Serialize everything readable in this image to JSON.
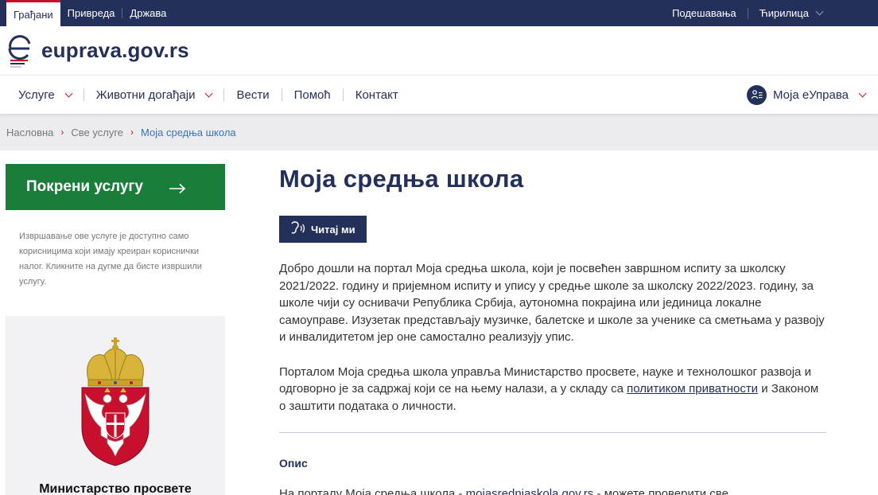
{
  "topbar": {
    "audiences": [
      "Грађани",
      "Привреда",
      "Држава"
    ],
    "settings": "Подешавања",
    "language": "Ћирилица"
  },
  "logo": {
    "text": "euprava.gov.rs"
  },
  "nav": {
    "services": "Услуге",
    "life_events": "Животни догађаји",
    "news": "Вести",
    "help": "Помоћ",
    "contact": "Контакт",
    "account": "Моја еУправа"
  },
  "breadcrumb": {
    "home": "Насловна",
    "all_services": "Све услуге",
    "current": "Моја средња школа"
  },
  "sidebar": {
    "start_button": "Покрени услугу",
    "note": "Извршавање ове услуге је доступно само корисницима који имају креиран кориснички налог. Кликните на дугме да бисте извршили услугу.",
    "ministry_name": "Министарство просвете"
  },
  "main": {
    "title": "Моја средња школа",
    "read_button": "Читај ми",
    "paragraph1": "Добро дошли на портал Моја средња школа, који је посвећен завршном испиту за школску 2021/2022. годину и пријемном испиту и упису у средње школе за школску 2022/2023. годину, за школе чији су оснивачи Република Србија, аутономна покрајина или јединица локалне самоуправе. Изузетак представљају музичке, балетске и школе за ученике са сметњама у развоју и инвалидитетом јер оне самостално реализују упис.",
    "paragraph2_before": "Порталом Моја средња школа управља Министарство просвете, науке и технолошког развоја и одговорно је за садржај који се на њему налази, а у складу са ",
    "paragraph2_link": "политиком приватности",
    "paragraph2_after": " и Законом о заштити података о личности.",
    "section_title": "Опис",
    "paragraph3_before": "На порталу Моја средња школа - ",
    "paragraph3_link": "mojasrednjaskola.gov.rs",
    "paragraph3_after": " - можете проверити све"
  },
  "colors": {
    "primary": "#23305a",
    "accent_red": "#c8102e",
    "start_green": "#1a7d3a"
  }
}
